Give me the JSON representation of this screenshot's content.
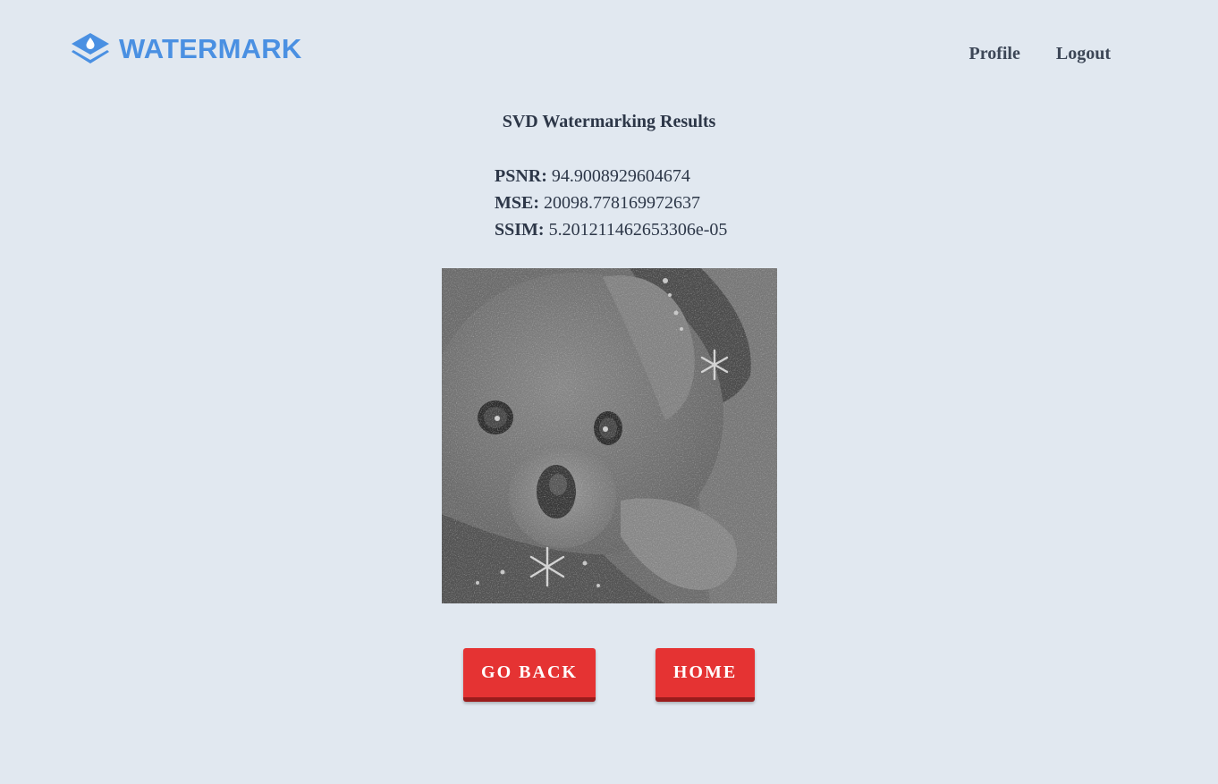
{
  "brand": {
    "name": "WATERMARK",
    "color": "#4a90e2",
    "icon": "water-drop-layers-icon"
  },
  "nav": {
    "profile": "Profile",
    "logout": "Logout"
  },
  "page": {
    "title": "SVD Watermarking Results"
  },
  "metrics": {
    "psnr_label": "PSNR:",
    "psnr_value": "94.9008929604674",
    "mse_label": "MSE:",
    "mse_value": "20098.778169972637",
    "ssim_label": "SSIM:",
    "ssim_value": "5.201211462653306e-05"
  },
  "image": {
    "subject": "grayscale watermarked teddy bear photo"
  },
  "buttons": {
    "go_back": "GO BACK",
    "home": "HOME",
    "color": "#e53333"
  },
  "colors": {
    "background": "#e1e8f0",
    "text": "#2d3748"
  }
}
